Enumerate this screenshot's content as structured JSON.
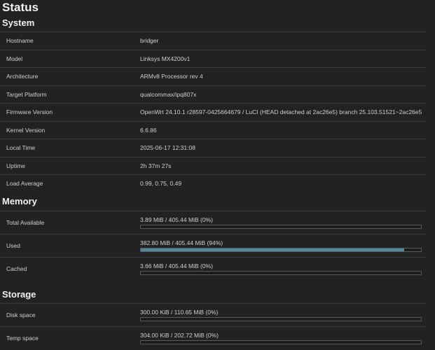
{
  "title": "Status",
  "system": {
    "heading": "System",
    "rows": [
      {
        "label": "Hostname",
        "value": "bridger"
      },
      {
        "label": "Model",
        "value": "Linksys MX4200v1"
      },
      {
        "label": "Architecture",
        "value": "ARMv8 Processor rev 4"
      },
      {
        "label": "Target Platform",
        "value": "qualcommax/ipq807x"
      },
      {
        "label": "Firmware Version",
        "value": "OpenWrt 24.10.1 r28597-0425664679 / LuCI (HEAD detached at 2ac26e5) branch 25.103.51521~2ac26e5"
      },
      {
        "label": "Kernel Version",
        "value": "6.6.86"
      },
      {
        "label": "Local Time",
        "value": "2025-06-17 12:31:08"
      },
      {
        "label": "Uptime",
        "value": "2h 37m 27s"
      },
      {
        "label": "Load Average",
        "value": "0.99, 0.75, 0.49"
      }
    ]
  },
  "memory": {
    "heading": "Memory",
    "rows": [
      {
        "label": "Total Available",
        "text": "3.89 MiB / 405.44 MiB (0%)",
        "fraction": 0.0
      },
      {
        "label": "Used",
        "text": "382.80 MiB / 405.44 MiB (94%)",
        "fraction": 0.94
      },
      {
        "label": "Cached",
        "text": "3.66 MiB / 405.44 MiB (0%)",
        "fraction": 0.0
      }
    ]
  },
  "storage": {
    "heading": "Storage",
    "rows": [
      {
        "label": "Disk space",
        "text": "300.00 KiB / 110.65 MiB (0%)",
        "fraction": 0.0
      },
      {
        "label": "Temp space",
        "text": "304.00 KiB / 202.72 MiB (0%)",
        "fraction": 0.0
      }
    ]
  },
  "colors": {
    "background": "#222222",
    "bar_fill": "#4f8a9a"
  }
}
